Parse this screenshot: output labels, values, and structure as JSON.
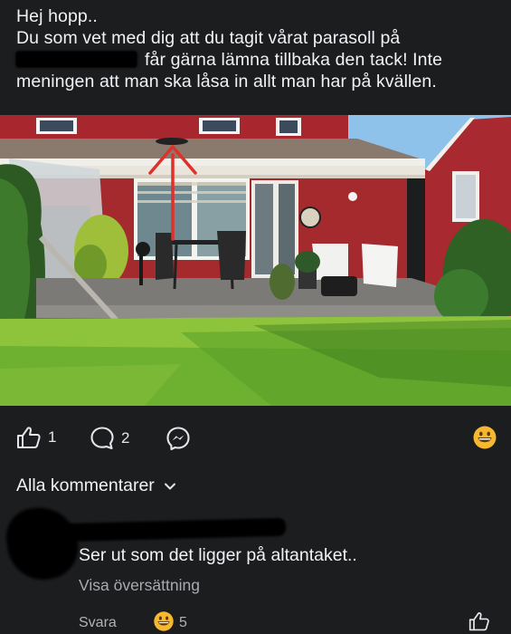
{
  "post": {
    "lines": [
      "Hej hopp..",
      "Du som vet med dig att du tagit vårat parasoll på",
      "får gärna lämna tillbaka den tack! Inte",
      "meningen att man ska låsa in allt man har på kvällen."
    ]
  },
  "actions": {
    "like_count": "1",
    "comment_count": "2",
    "like_icon": "thumbs-up-icon",
    "comment_icon": "comment-bubble-icon",
    "messenger_icon": "messenger-icon",
    "reaction_icon": "grinning-emoji-icon"
  },
  "comments_section": {
    "sort_label": "Alla kommentarer",
    "comment": {
      "text": "Ser ut som det ligger på altantaket..",
      "translate_label": "Visa översättning",
      "reply_label": "Svara",
      "reaction_count": "5"
    }
  },
  "colors": {
    "background": "#1c1d1f",
    "text": "#f0f2f5",
    "muted": "#a8abaf",
    "emoji": "#f5b82e",
    "arrow": "#e0302a"
  }
}
